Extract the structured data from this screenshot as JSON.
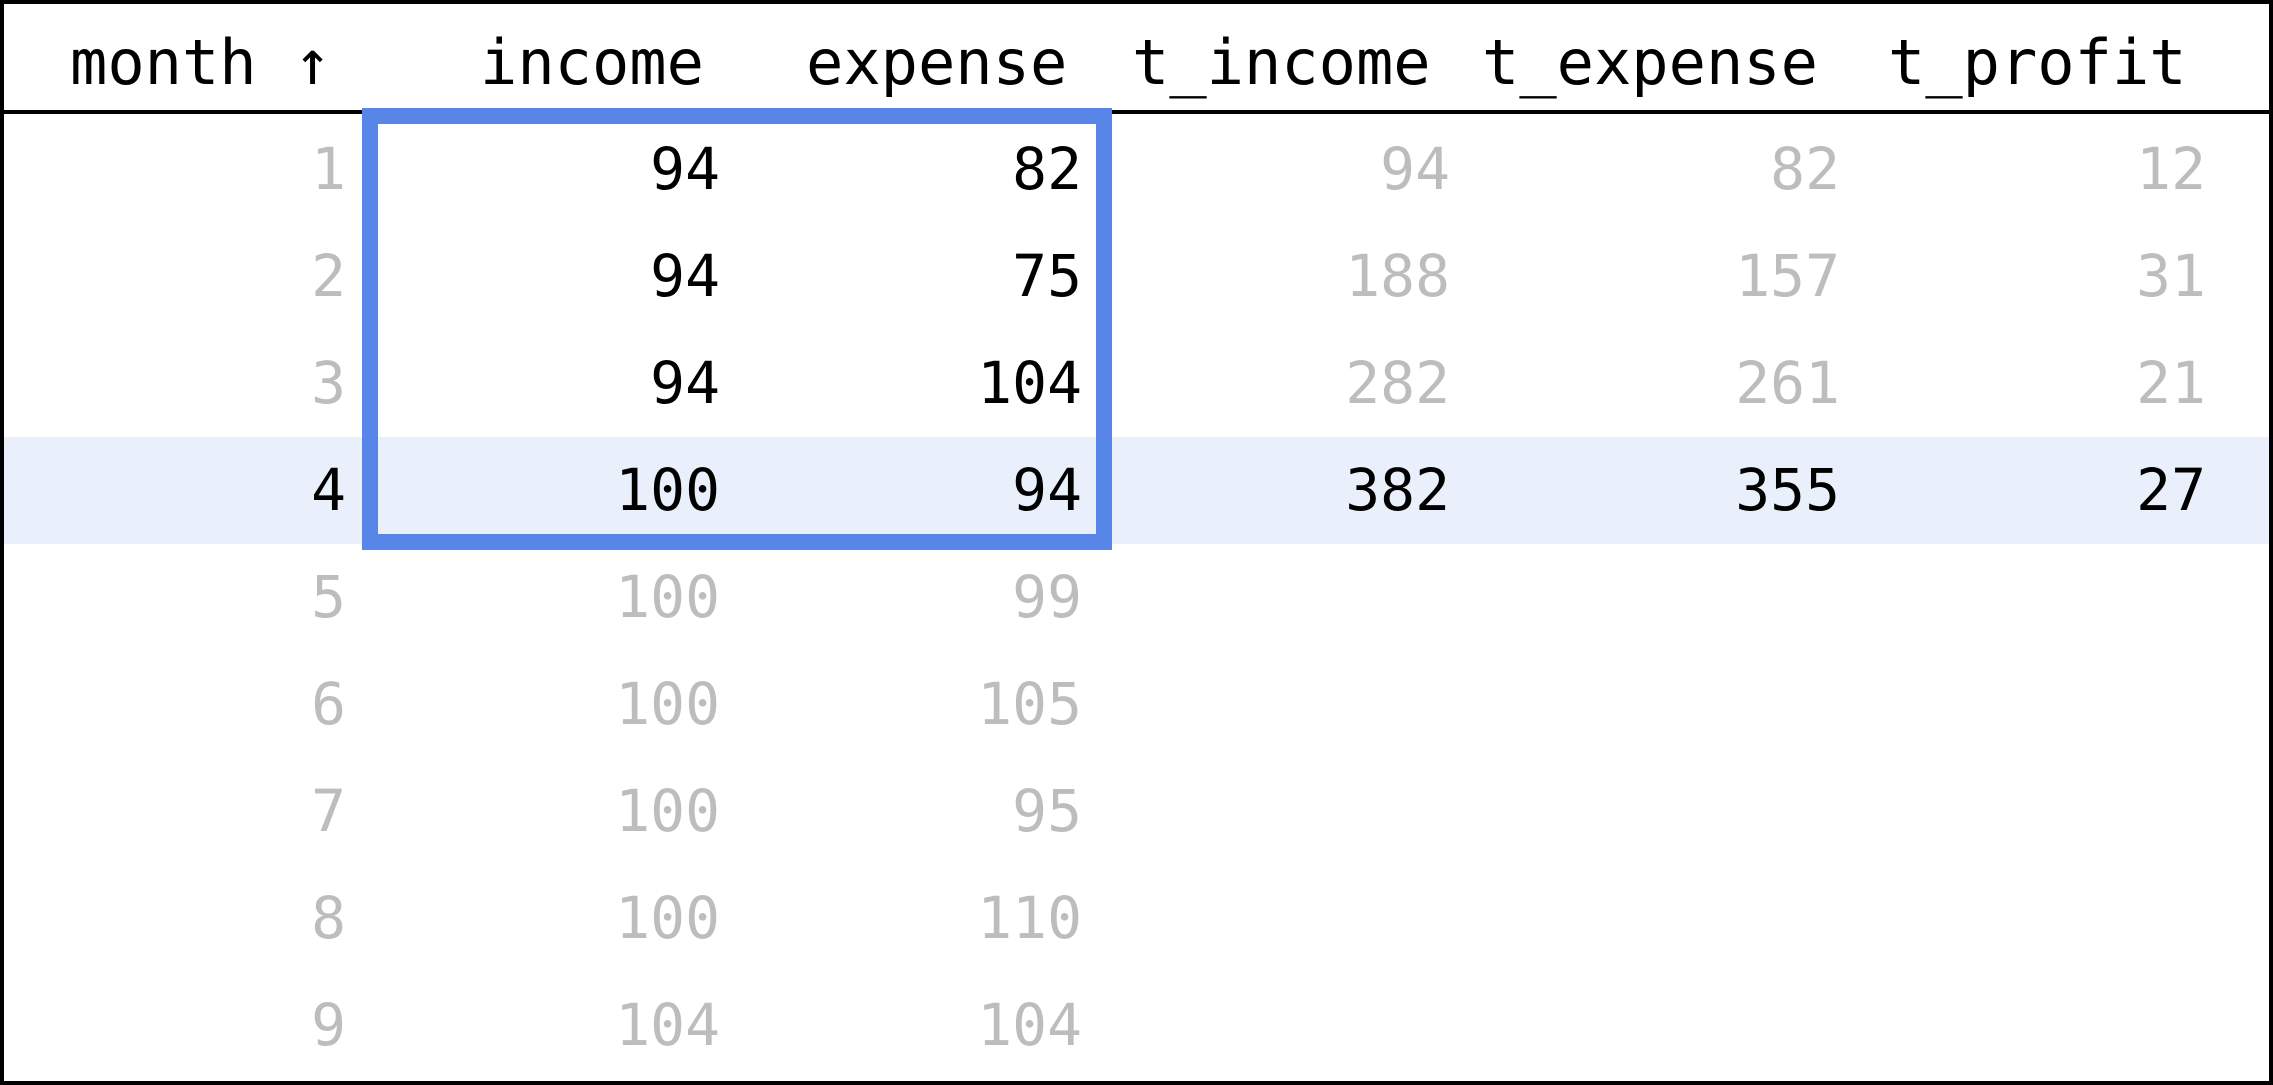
{
  "table": {
    "columns": [
      "month ↑",
      "income",
      "expense",
      "t_income",
      "t_expense",
      "t_profit"
    ],
    "rows": [
      {
        "month": "1",
        "income": "94",
        "expense": "82",
        "t_income": "94",
        "t_expense": "82",
        "t_profit": "12"
      },
      {
        "month": "2",
        "income": "94",
        "expense": "75",
        "t_income": "188",
        "t_expense": "157",
        "t_profit": "31"
      },
      {
        "month": "3",
        "income": "94",
        "expense": "104",
        "t_income": "282",
        "t_expense": "261",
        "t_profit": "21"
      },
      {
        "month": "4",
        "income": "100",
        "expense": "94",
        "t_income": "382",
        "t_expense": "355",
        "t_profit": "27"
      },
      {
        "month": "5",
        "income": "100",
        "expense": "99",
        "t_income": "",
        "t_expense": "",
        "t_profit": ""
      },
      {
        "month": "6",
        "income": "100",
        "expense": "105",
        "t_income": "",
        "t_expense": "",
        "t_profit": ""
      },
      {
        "month": "7",
        "income": "100",
        "expense": "95",
        "t_income": "",
        "t_expense": "",
        "t_profit": ""
      },
      {
        "month": "8",
        "income": "100",
        "expense": "110",
        "t_income": "",
        "t_expense": "",
        "t_profit": ""
      },
      {
        "month": "9",
        "income": "104",
        "expense": "104",
        "t_income": "",
        "t_expense": "",
        "t_profit": ""
      }
    ],
    "active_row": 3,
    "selection": {
      "columns": [
        "income",
        "expense"
      ],
      "rows_from": 0,
      "rows_to": 3
    },
    "colors": {
      "selection_border": "#5885e8",
      "active_row_bg": "#e9f0fb",
      "dim_text": "#bdbdbd",
      "strong_text": "#000000"
    }
  }
}
